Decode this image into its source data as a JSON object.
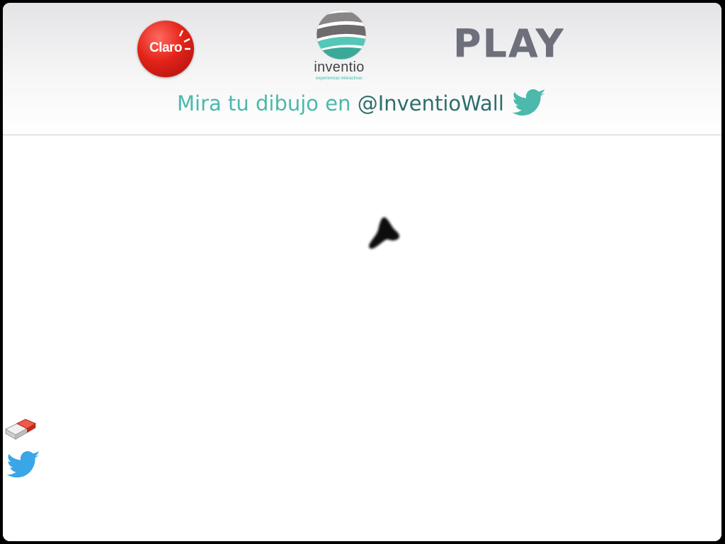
{
  "header": {
    "logos": {
      "claro": "Claro",
      "inventio_name": "inventio",
      "inventio_tagline": "experiencias interactivas",
      "play": "PLAY"
    },
    "tagline": {
      "prefix": "Mira tu dibujo en ",
      "handle": "@InventioWall"
    }
  },
  "colors": {
    "teal": "#4cb9ac",
    "dark_teal": "#2f6e6c",
    "claro_red": "#e3231a",
    "twitter_blue": "#3aa6e6",
    "eraser_red": "#e53b2c"
  },
  "canvas": {
    "tools": [
      {
        "id": "eraser",
        "icon": "eraser-icon"
      },
      {
        "id": "share",
        "icon": "twitter-icon"
      }
    ]
  }
}
